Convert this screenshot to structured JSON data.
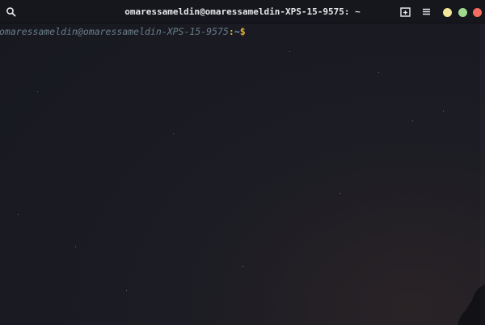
{
  "window": {
    "title": "omaressameldin@omaressameldin-XPS-15-9575: ~"
  },
  "titlebar": {
    "search_icon": "search-icon",
    "new_tab_icon": "new-tab-icon",
    "menu_icon": "hamburger-menu-icon",
    "buttons": {
      "minimize_color": "#f3e79a",
      "maximize_color": "#9ed98f",
      "close_color": "#f26d5f"
    }
  },
  "terminal": {
    "prompt": {
      "user_host": "omaressameldin@omaressameldin-XPS-15-9575",
      "separator": ":",
      "path": "~",
      "symbol": "$"
    },
    "colors": {
      "background": "#1a1b23",
      "user_host": "#6b7f8a",
      "path": "#6ea7c9",
      "symbol": "#e1b33a"
    }
  }
}
